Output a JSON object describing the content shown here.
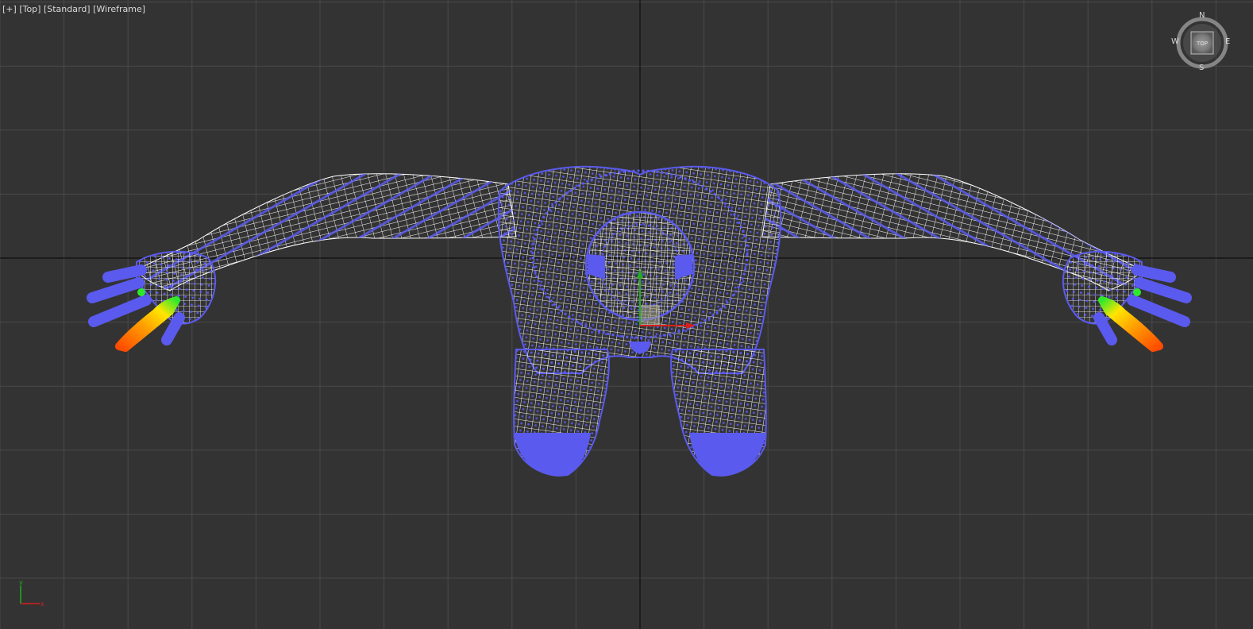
{
  "viewport": {
    "menu_plus": "[+]",
    "view_name": "[Top]",
    "shading_style": "[Standard]",
    "display_mode": "[Wireframe]"
  },
  "viewcube": {
    "face_label": "TOP",
    "north": "N",
    "south": "S",
    "east": "E",
    "west": "W"
  },
  "colors": {
    "background": "#333333",
    "grid_line": "#4a4a4a",
    "home_axis": "#0f0f0f",
    "wire_white": "#ffffff",
    "wire_blue": "#5a5aee",
    "weight_orange": "#ff5a00",
    "weight_yellow": "#ffe600",
    "weight_green": "#2ee82e",
    "axis_x": "#d42020",
    "axis_y": "#20b020"
  },
  "icons": {
    "viewcube": "viewcube-navigation-icon",
    "world_axis": "world-axis-tripod-icon",
    "transform_gizmo": "transform-gizmo-icon"
  }
}
